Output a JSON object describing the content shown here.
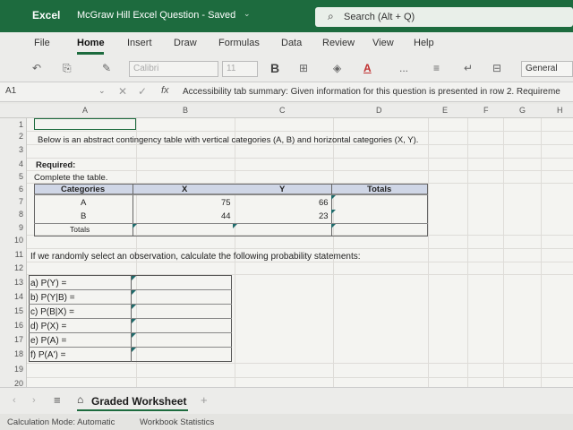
{
  "titlebar": {
    "app_name": "Excel",
    "document": "McGraw Hill Excel Question  -  Saved",
    "chevron": "⌄",
    "search_icon": "⌕",
    "search_placeholder": "Search (Alt + Q)"
  },
  "menu": [
    {
      "label": "File"
    },
    {
      "label": "Home"
    },
    {
      "label": "Insert"
    },
    {
      "label": "Draw"
    },
    {
      "label": "Formulas"
    },
    {
      "label": "Data"
    },
    {
      "label": "Review"
    },
    {
      "label": "View"
    },
    {
      "label": "Help"
    }
  ],
  "ribbon": {
    "undo_icon": "↶",
    "clipboard_icon": "⎘",
    "format_painter_icon": "✎",
    "font_name": "Calibri",
    "font_size": "11",
    "bold_label": "B",
    "borders_icon": "⊞",
    "fill_icon": "◈",
    "font_color_label": "A",
    "more_label": "...",
    "align_icon": "≡",
    "wrap_icon": "↵",
    "merge_icon": "⊟",
    "number_format": "General"
  },
  "formula_bar": {
    "name_box": "A1",
    "name_box_chevron": "⌄",
    "cancel_icon": "✕",
    "enter_icon": "✓",
    "fx_label": "fx",
    "content": "Accessibility tab summary: Given information for this question is presented in row 2. Requireme"
  },
  "columns": [
    "A",
    "B",
    "C",
    "D",
    "E",
    "F",
    "G",
    "H"
  ],
  "rows": [
    "1",
    "2",
    "3",
    "4",
    "5",
    "6",
    "7",
    "8",
    "9",
    "10",
    "11",
    "12",
    "13",
    "14",
    "15",
    "16",
    "17",
    "18",
    "19",
    "20"
  ],
  "cells": {
    "row2": "Below is an abstract contingency table with vertical categories (A, B) and horizontal categories (X, Y).",
    "row4": "Required:",
    "row5": "Complete the table.",
    "table_header": [
      "Categories",
      "X",
      "Y",
      "Totals"
    ],
    "table_rows": [
      {
        "label": "A",
        "x": "75",
        "y": "66"
      },
      {
        "label": "B",
        "x": "44",
        "y": "23"
      },
      {
        "label": "Totals",
        "x": "",
        "y": ""
      }
    ],
    "row11": "If we randomly select an observation, calculate the following probability statements:",
    "prob_items": [
      "a) P(Y) =",
      "b) P(Y|B) =",
      "c) P(B|X) =",
      "d) P(X) =",
      "e) P(A) =",
      "f) P(A') ="
    ]
  },
  "sheet_tabs": {
    "menu_icon": "≡",
    "lock_icon": "⌂",
    "active_tab": "Graded Worksheet",
    "add_label": "+"
  },
  "status": {
    "calc_mode": "Calculation Mode: Automatic",
    "workbook_stats": "Workbook Statistics"
  },
  "colors": {
    "brand": "#1d6b3e",
    "table_header_fill": "#cfd6e6",
    "input_marker": "#1f6b6b"
  }
}
